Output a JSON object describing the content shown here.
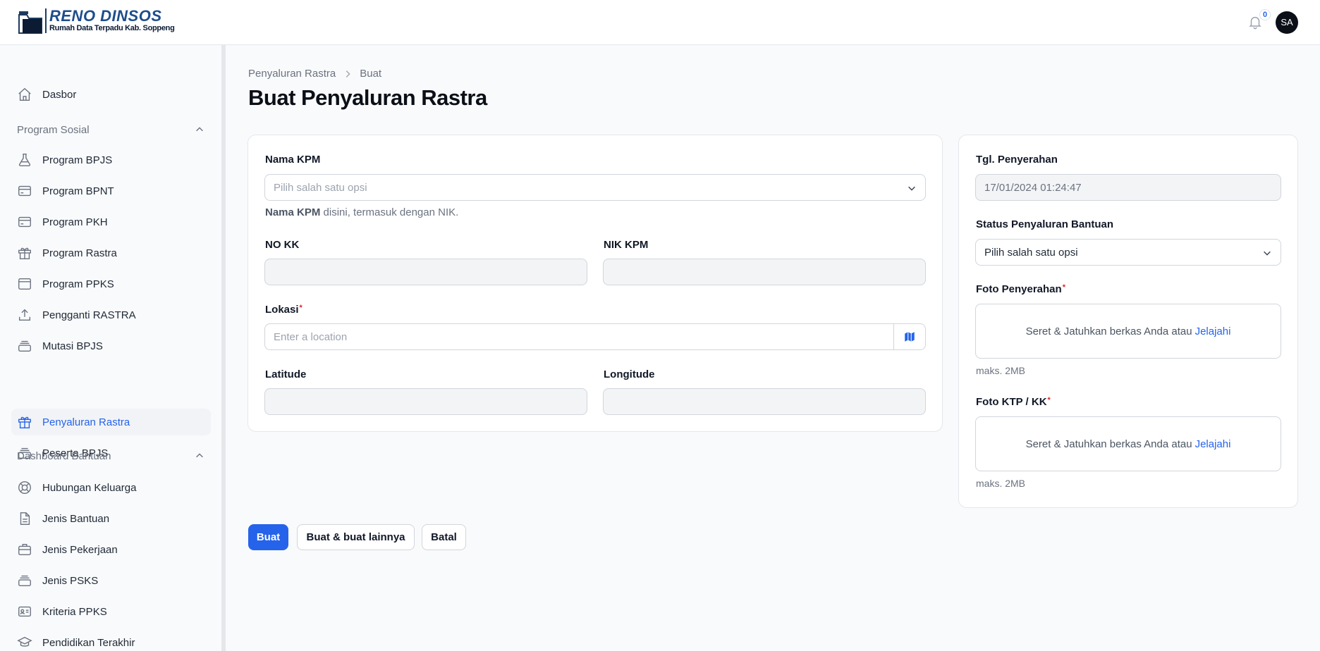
{
  "app": {
    "logo_title": "RENO DINSOS",
    "logo_subtitle": "Rumah Data Terpadu Kab. Soppeng",
    "notification_count": "0",
    "avatar_initials": "SA"
  },
  "sidebar": {
    "top_items": [
      {
        "label": "Dasbor",
        "icon": "home-icon"
      }
    ],
    "groups": [
      {
        "label": "Program Sosial",
        "items": [
          {
            "label": "Program BPJS",
            "icon": "flask-icon"
          },
          {
            "label": "Program BPNT",
            "icon": "credit-card-icon"
          },
          {
            "label": "Program PKH",
            "icon": "credit-card-icon"
          },
          {
            "label": "Program Rastra",
            "icon": "gift-icon"
          },
          {
            "label": "Program PPKS",
            "icon": "window-icon"
          },
          {
            "label": "Pengganti RASTRA",
            "icon": "upload-icon"
          },
          {
            "label": "Mutasi BPJS",
            "icon": "stack-icon"
          },
          {
            "label": "Penyaluran Rastra",
            "icon": "gift-icon",
            "active": true
          },
          {
            "label": "Peserta BPJS",
            "icon": "stack-icon"
          }
        ]
      },
      {
        "label": "Dashboard Bantuan",
        "items": [
          {
            "label": "Hubungan Keluarga",
            "icon": "lifebuoy-icon"
          },
          {
            "label": "Jenis Bantuan",
            "icon": "document-icon"
          },
          {
            "label": "Jenis Pekerjaan",
            "icon": "briefcase-icon"
          },
          {
            "label": "Jenis PSKS",
            "icon": "stack-icon"
          },
          {
            "label": "Kriteria PPKS",
            "icon": "id-card-icon"
          },
          {
            "label": "Pendidikan Terakhir",
            "icon": "graduation-cap-icon"
          }
        ]
      }
    ]
  },
  "breadcrumb": {
    "parent": "Penyaluran Rastra",
    "current": "Buat"
  },
  "page_title": "Buat Penyaluran Rastra",
  "form": {
    "nama_kpm": {
      "label": "Nama KPM",
      "placeholder": "Pilih salah satu opsi",
      "hint_bold": "Nama KPM",
      "hint_rest": " disini, termasuk dengan NIK."
    },
    "no_kk": {
      "label": "NO KK",
      "value": ""
    },
    "nik_kpm": {
      "label": "NIK KPM",
      "value": ""
    },
    "lokasi": {
      "label": "Lokasi",
      "placeholder": "Enter a location",
      "required": true
    },
    "latitude": {
      "label": "Latitude",
      "value": ""
    },
    "longitude": {
      "label": "Longitude",
      "value": ""
    },
    "tgl_penyerahan": {
      "label": "Tgl. Penyerahan",
      "value": "17/01/2024 01:24:47"
    },
    "status_penyaluran": {
      "label": "Status Penyaluran Bantuan",
      "value": "Pilih salah satu opsi"
    },
    "foto_penyerahan": {
      "label": "Foto Penyerahan",
      "required": true,
      "drop_text": "Seret & Jatuhkan berkas Anda atau",
      "browse_link": "Jelajahi",
      "max_note": "maks. 2MB"
    },
    "foto_ktp_kk": {
      "label": "Foto KTP / KK",
      "required": true,
      "drop_text": "Seret & Jatuhkan berkas Anda atau",
      "browse_link": "Jelajahi",
      "max_note": "maks. 2MB"
    }
  },
  "actions": {
    "create": "Buat",
    "create_another": "Buat & buat lainnya",
    "cancel": "Batal"
  },
  "colors": {
    "primary": "#2563eb",
    "required": "#dc2626",
    "logo_blue": "#1e4d8c"
  }
}
